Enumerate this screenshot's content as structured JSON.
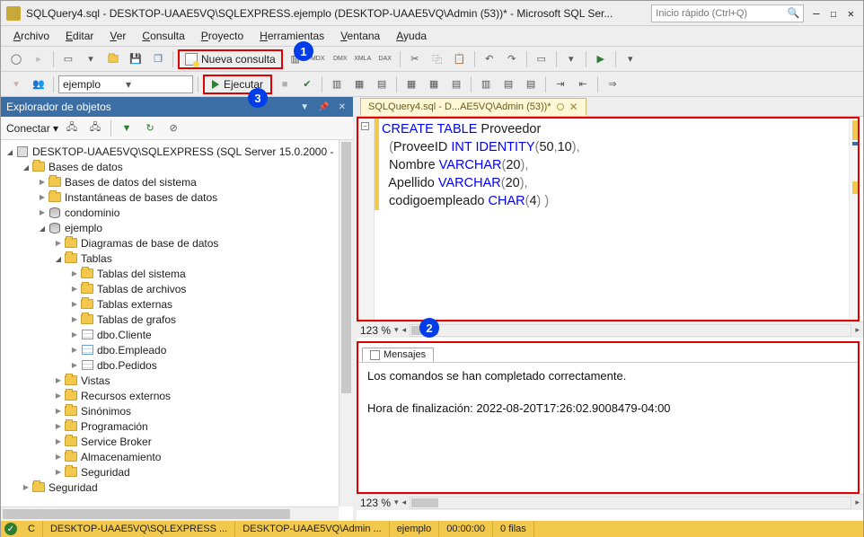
{
  "titlebar": {
    "title": "SQLQuery4.sql - DESKTOP-UAAE5VQ\\SQLEXPRESS.ejemplo (DESKTOP-UAAE5VQ\\Admin (53))* - Microsoft SQL Ser...",
    "quicklaunch_placeholder": "Inicio rápido (Ctrl+Q)"
  },
  "menubar": [
    "Archivo",
    "Editar",
    "Ver",
    "Consulta",
    "Proyecto",
    "Herramientas",
    "Ventana",
    "Ayuda"
  ],
  "toolbar1": {
    "nueva_consulta": "Nueva consulta",
    "callout": "1"
  },
  "toolbar2": {
    "db_selected": "ejemplo",
    "ejecutar": "Ejecutar",
    "callout": "3"
  },
  "object_explorer": {
    "title": "Explorador de objetos",
    "connect_label": "Conectar ▾",
    "server": "DESKTOP-UAAE5VQ\\SQLEXPRESS (SQL Server 15.0.2000 - ",
    "tree": [
      {
        "ind": 1,
        "tw": "open",
        "icon": "folder",
        "label": "Bases de datos"
      },
      {
        "ind": 2,
        "tw": "closed",
        "icon": "folder",
        "label": "Bases de datos del sistema"
      },
      {
        "ind": 2,
        "tw": "closed",
        "icon": "folder",
        "label": "Instantáneas de bases de datos"
      },
      {
        "ind": 2,
        "tw": "closed",
        "icon": "db",
        "label": "condominio"
      },
      {
        "ind": 2,
        "tw": "open",
        "icon": "db",
        "label": "ejemplo"
      },
      {
        "ind": 3,
        "tw": "closed",
        "icon": "folder",
        "label": "Diagramas de base de datos"
      },
      {
        "ind": 3,
        "tw": "open",
        "icon": "folder",
        "label": "Tablas"
      },
      {
        "ind": 4,
        "tw": "closed",
        "icon": "folder",
        "label": "Tablas del sistema"
      },
      {
        "ind": 4,
        "tw": "closed",
        "icon": "folder",
        "label": "Tablas de archivos"
      },
      {
        "ind": 4,
        "tw": "closed",
        "icon": "folder",
        "label": "Tablas externas"
      },
      {
        "ind": 4,
        "tw": "closed",
        "icon": "folder",
        "label": "Tablas de grafos"
      },
      {
        "ind": 4,
        "tw": "closed",
        "icon": "tbl",
        "label": "dbo.Cliente"
      },
      {
        "ind": 4,
        "tw": "closed",
        "icon": "tbl",
        "label": "dbo.Empleado"
      },
      {
        "ind": 4,
        "tw": "closed",
        "icon": "tbl",
        "label": "dbo.Pedidos"
      },
      {
        "ind": 3,
        "tw": "closed",
        "icon": "folder",
        "label": "Vistas"
      },
      {
        "ind": 3,
        "tw": "closed",
        "icon": "folder",
        "label": "Recursos externos"
      },
      {
        "ind": 3,
        "tw": "closed",
        "icon": "folder",
        "label": "Sinónimos"
      },
      {
        "ind": 3,
        "tw": "closed",
        "icon": "folder",
        "label": "Programación"
      },
      {
        "ind": 3,
        "tw": "closed",
        "icon": "folder",
        "label": "Service Broker"
      },
      {
        "ind": 3,
        "tw": "closed",
        "icon": "folder",
        "label": "Almacenamiento"
      },
      {
        "ind": 3,
        "tw": "closed",
        "icon": "folder",
        "label": "Seguridad"
      },
      {
        "ind": 1,
        "tw": "closed",
        "icon": "folder",
        "label": "Seguridad"
      }
    ]
  },
  "editor": {
    "tab_label": "SQLQuery4.sql - D...AE5VQ\\Admin (53))*",
    "callout": "2",
    "zoom": "123 %",
    "code_lines": [
      {
        "segments": [
          {
            "cls": "kw",
            "t": "CREATE"
          },
          {
            "cls": "",
            "t": " "
          },
          {
            "cls": "kw",
            "t": "TABLE"
          },
          {
            "cls": "",
            "t": " Proveedor"
          }
        ]
      },
      {
        "segments": [
          {
            "cls": "",
            "t": "  "
          },
          {
            "cls": "op",
            "t": "("
          },
          {
            "cls": "",
            "t": "ProveeID "
          },
          {
            "cls": "kw",
            "t": "INT"
          },
          {
            "cls": "",
            "t": " "
          },
          {
            "cls": "kw",
            "t": "IDENTITY"
          },
          {
            "cls": "op",
            "t": "("
          },
          {
            "cls": "",
            "t": "50"
          },
          {
            "cls": "op",
            "t": ","
          },
          {
            "cls": "",
            "t": "10"
          },
          {
            "cls": "op",
            "t": "),"
          }
        ]
      },
      {
        "segments": [
          {
            "cls": "",
            "t": "  Nombre "
          },
          {
            "cls": "kw",
            "t": "VARCHAR"
          },
          {
            "cls": "op",
            "t": "("
          },
          {
            "cls": "",
            "t": "20"
          },
          {
            "cls": "op",
            "t": "),"
          }
        ]
      },
      {
        "segments": [
          {
            "cls": "",
            "t": "  Apellido "
          },
          {
            "cls": "kw",
            "t": "VARCHAR"
          },
          {
            "cls": "op",
            "t": "("
          },
          {
            "cls": "",
            "t": "20"
          },
          {
            "cls": "op",
            "t": "),"
          }
        ]
      },
      {
        "segments": [
          {
            "cls": "",
            "t": "  codigoempleado "
          },
          {
            "cls": "kw",
            "t": "CHAR"
          },
          {
            "cls": "op",
            "t": "("
          },
          {
            "cls": "",
            "t": "4"
          },
          {
            "cls": "op",
            "t": ")"
          },
          {
            "cls": "",
            "t": " "
          },
          {
            "cls": "op",
            "t": ")"
          }
        ]
      }
    ]
  },
  "messages": {
    "tab_label": "Mensajes",
    "lines": [
      "Los comandos se han completado correctamente.",
      "",
      "Hora de finalización: 2022-08-20T17:26:02.9008479-04:00"
    ],
    "zoom": "123 %"
  },
  "statusbar": {
    "c": "C",
    "server": "DESKTOP-UAAE5VQ\\SQLEXPRESS ...",
    "user": "DESKTOP-UAAE5VQ\\Admin ...",
    "db": "ejemplo",
    "time": "00:00:00",
    "rows": "0 filas"
  }
}
